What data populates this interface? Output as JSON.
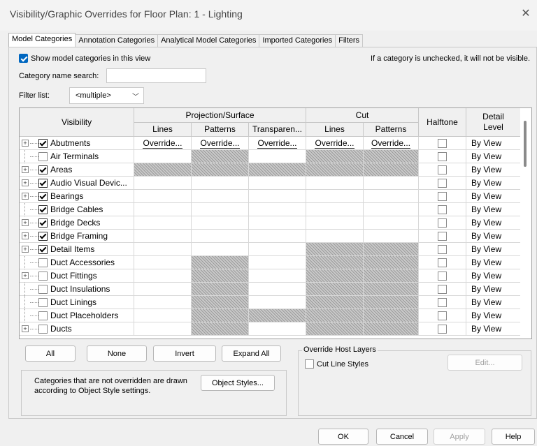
{
  "window": {
    "title": "Visibility/Graphic Overrides for Floor Plan: 1 - Lighting",
    "close": "✕"
  },
  "tabs": [
    {
      "label": "Model Categories"
    },
    {
      "label": "Annotation Categories"
    },
    {
      "label": "Analytical Model Categories"
    },
    {
      "label": "Imported Categories"
    },
    {
      "label": "Filters"
    }
  ],
  "show_checkbox_label": "Show model categories in this view",
  "hint": "If a category is unchecked, it will not be visible.",
  "search": {
    "label": "Category name search:",
    "value": ""
  },
  "filter": {
    "label": "Filter list:",
    "value": "<multiple>"
  },
  "table": {
    "headers": {
      "visibility": "Visibility",
      "projection": "Projection/Surface",
      "cut": "Cut",
      "halftone": "Halftone",
      "detail_level": "Detail Level",
      "lines": "Lines",
      "patterns": "Patterns",
      "transparency": "Transparen...",
      "cut_lines": "Lines",
      "cut_patterns": "Patterns"
    },
    "override_label": "Override...",
    "rows": [
      {
        "name": "Abutments",
        "expand": true,
        "checked": true,
        "selected": true,
        "hatch": [
          0,
          0,
          0,
          0,
          0
        ],
        "detail": "By View"
      },
      {
        "name": "Air Terminals",
        "expand": false,
        "checked": false,
        "selected": false,
        "hatch": [
          0,
          1,
          0,
          1,
          1
        ],
        "detail": "By View"
      },
      {
        "name": "Areas",
        "expand": true,
        "checked": true,
        "selected": false,
        "hatch": [
          1,
          1,
          1,
          1,
          1
        ],
        "detail": "By View"
      },
      {
        "name": "Audio Visual Devic...",
        "expand": true,
        "checked": true,
        "selected": false,
        "hatch": [
          0,
          0,
          0,
          0,
          0
        ],
        "detail": "By View"
      },
      {
        "name": "Bearings",
        "expand": true,
        "checked": true,
        "selected": false,
        "hatch": [
          0,
          0,
          0,
          0,
          0
        ],
        "detail": "By View"
      },
      {
        "name": "Bridge Cables",
        "expand": false,
        "checked": true,
        "selected": false,
        "hatch": [
          0,
          0,
          0,
          0,
          0
        ],
        "detail": "By View"
      },
      {
        "name": "Bridge Decks",
        "expand": true,
        "checked": true,
        "selected": false,
        "hatch": [
          0,
          0,
          0,
          0,
          0
        ],
        "detail": "By View"
      },
      {
        "name": "Bridge Framing",
        "expand": true,
        "checked": true,
        "selected": false,
        "hatch": [
          0,
          0,
          0,
          0,
          0
        ],
        "detail": "By View"
      },
      {
        "name": "Detail Items",
        "expand": true,
        "checked": true,
        "selected": false,
        "hatch": [
          0,
          0,
          0,
          1,
          1
        ],
        "detail": "By View"
      },
      {
        "name": "Duct Accessories",
        "expand": false,
        "checked": false,
        "selected": false,
        "hatch": [
          0,
          1,
          0,
          1,
          1
        ],
        "detail": "By View"
      },
      {
        "name": "Duct Fittings",
        "expand": true,
        "checked": false,
        "selected": false,
        "hatch": [
          0,
          1,
          0,
          1,
          1
        ],
        "detail": "By View"
      },
      {
        "name": "Duct Insulations",
        "expand": false,
        "checked": false,
        "selected": false,
        "hatch": [
          0,
          1,
          0,
          1,
          1
        ],
        "detail": "By View"
      },
      {
        "name": "Duct Linings",
        "expand": false,
        "checked": false,
        "selected": false,
        "hatch": [
          0,
          1,
          0,
          1,
          1
        ],
        "detail": "By View"
      },
      {
        "name": "Duct Placeholders",
        "expand": false,
        "checked": false,
        "selected": false,
        "hatch": [
          0,
          1,
          1,
          1,
          1
        ],
        "detail": "By View"
      },
      {
        "name": "Ducts",
        "expand": true,
        "checked": false,
        "selected": false,
        "hatch": [
          0,
          1,
          0,
          1,
          1
        ],
        "detail": "By View"
      }
    ]
  },
  "buttons": {
    "all": "All",
    "none": "None",
    "invert": "Invert",
    "expand_all": "Expand All",
    "object_styles": "Object Styles...",
    "edit": "Edit...",
    "ok": "OK",
    "cancel": "Cancel",
    "apply": "Apply",
    "help": "Help"
  },
  "override_host": {
    "title": "Override Host Layers",
    "cut_line_styles": "Cut Line Styles"
  },
  "note": "Categories that are not overridden are drawn according to Object Style settings.",
  "colors": {
    "accent": "#0067c0",
    "hatch": "#9c9c9c"
  }
}
